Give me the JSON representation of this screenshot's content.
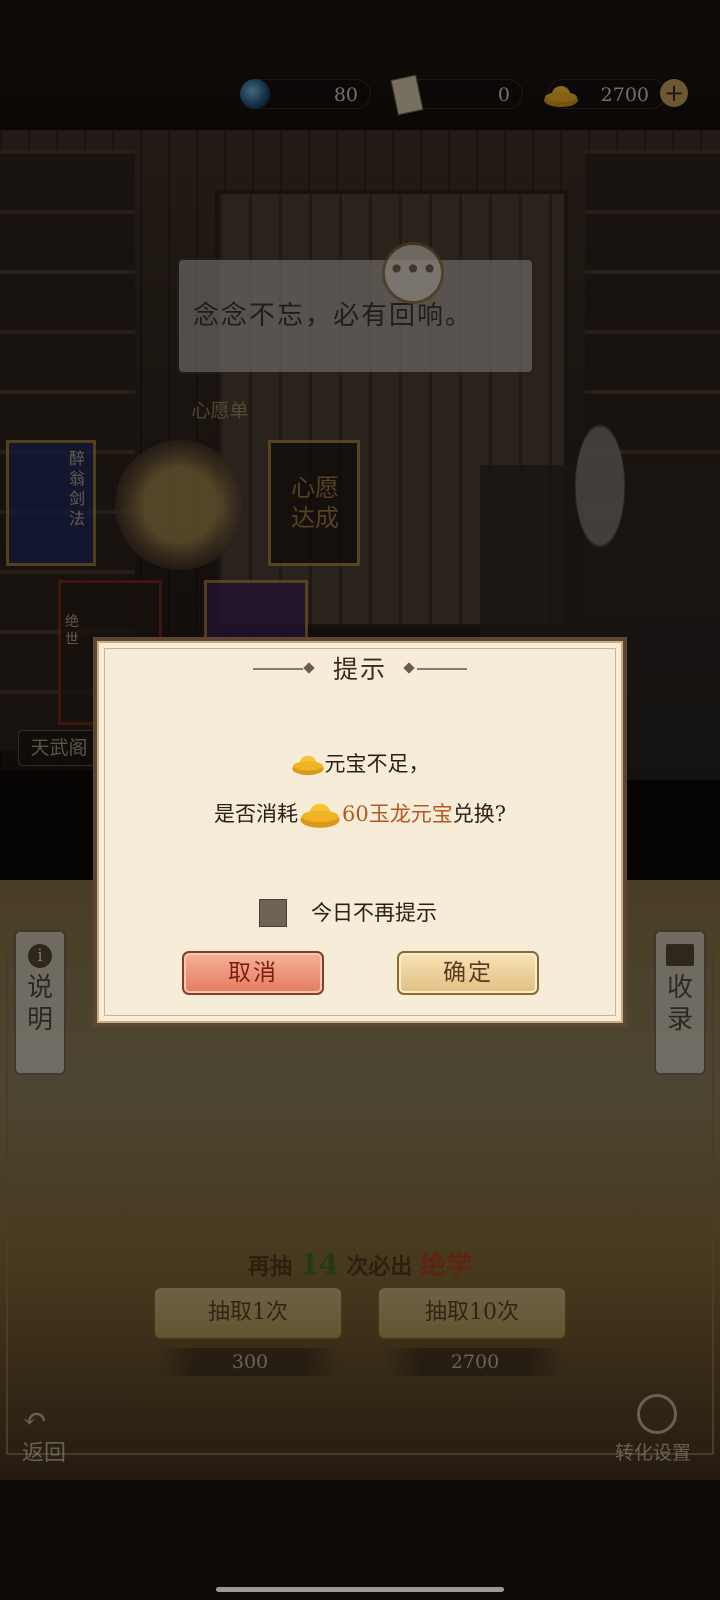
{
  "currencies": [
    {
      "icon": "blue-orb-icon",
      "value": "80"
    },
    {
      "icon": "ticket-icon",
      "value": "0"
    },
    {
      "icon": "gold-ingot-icon",
      "value": "2700"
    }
  ],
  "scene": {
    "speech": "念念不忘，必有回响。",
    "wish_list_label": "心愿单",
    "card_wish_done": "心愿达成",
    "card_skill": "醉翁剑法",
    "card_rank": "绝世",
    "pavilion_tag": "天武阁"
  },
  "panel": {
    "left_tag": "说明",
    "right_tag": "收录",
    "pity_prefix": "再抽",
    "pity_count": "14",
    "pity_mid": "次必出",
    "pity_item": "绝学",
    "draw_once": "抽取1次",
    "draw_ten": "抽取10次",
    "cost_once": "300",
    "cost_ten": "2700",
    "back": "返回",
    "convert_settings": "转化设置"
  },
  "dialog": {
    "title": "提示",
    "line1": "元宝不足，",
    "line2_prefix": "是否消耗",
    "line2_amount": "60玉龙元宝",
    "line2_suffix": "兑换?",
    "dont_remind": "今日不再提示",
    "cancel": "取消",
    "confirm": "确定"
  },
  "colors": {
    "dialog_bg": "#f6ecd8",
    "highlight": "#b8571f",
    "cancel_button": "#e47c5f",
    "confirm_button": "#e2bf82"
  }
}
